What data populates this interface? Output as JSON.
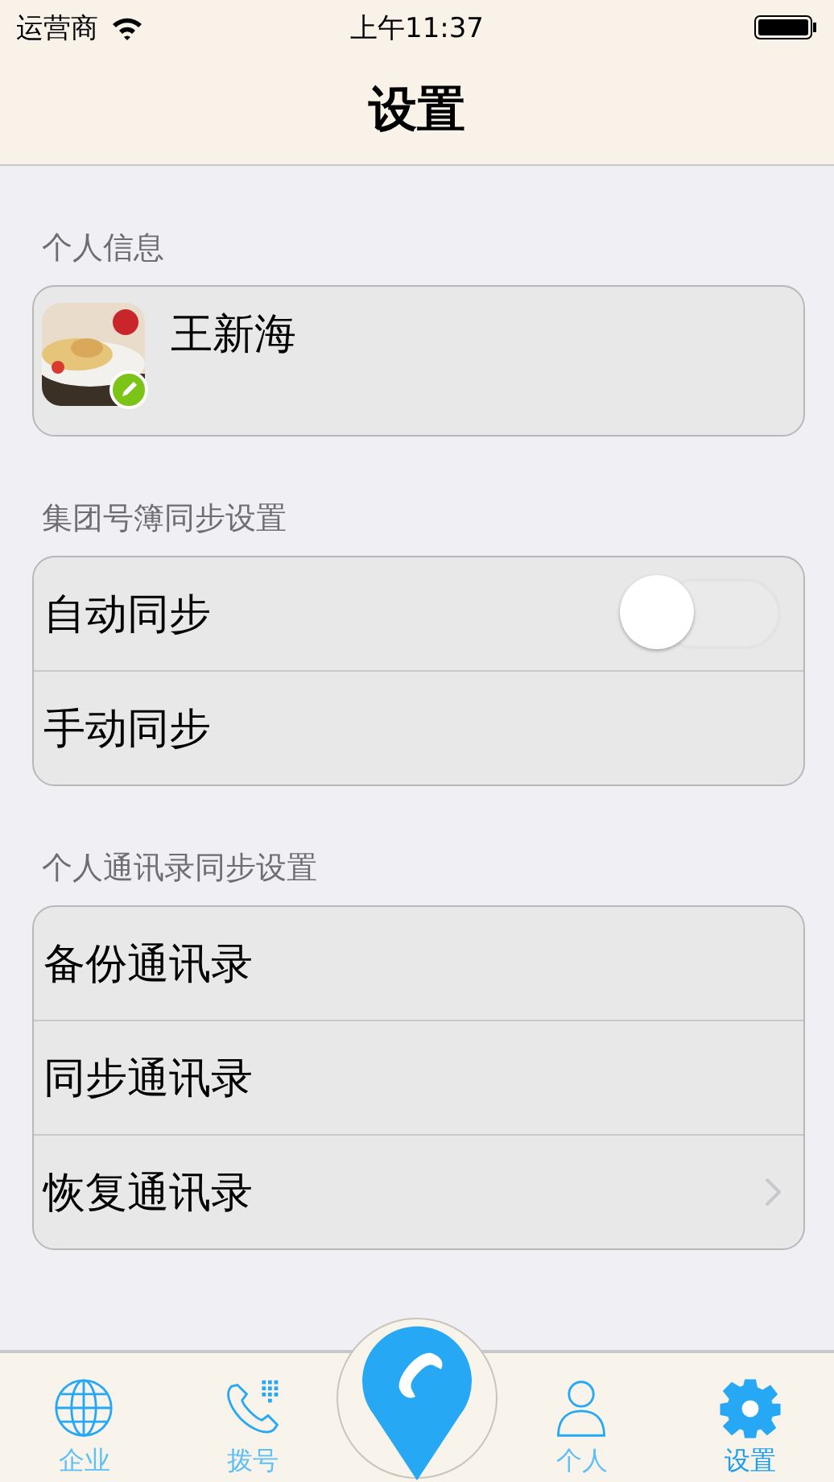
{
  "status_bar": {
    "carrier": "运营商",
    "time": "上午11:37"
  },
  "nav": {
    "title": "设置"
  },
  "profile": {
    "header": "个人信息",
    "name": "王新海"
  },
  "sections": [
    {
      "header": "集团号簿同步设置",
      "rows": [
        {
          "label": "自动同步",
          "kind": "toggle",
          "on": false
        },
        {
          "label": "手动同步",
          "kind": "plain"
        }
      ]
    },
    {
      "header": "个人通讯录同步设置",
      "rows": [
        {
          "label": "备份通讯录",
          "kind": "plain"
        },
        {
          "label": "同步通讯录",
          "kind": "plain"
        },
        {
          "label": "恢复通讯录",
          "kind": "disclosure"
        }
      ]
    }
  ],
  "tabs": [
    {
      "label": "企业",
      "kind": "globe",
      "selected": false
    },
    {
      "label": "拨号",
      "kind": "dialer",
      "selected": false
    },
    {
      "kind": "center"
    },
    {
      "label": "个人",
      "kind": "person",
      "selected": false
    },
    {
      "label": "设置",
      "kind": "gear",
      "selected": true
    }
  ]
}
